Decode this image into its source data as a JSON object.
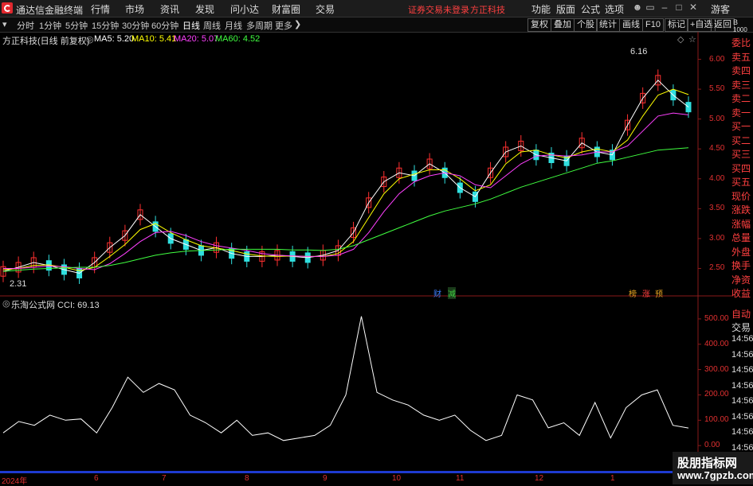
{
  "title_bar": {
    "app_name": "通达信金融终端",
    "menus": [
      "行情",
      "市场",
      "资讯",
      "发现",
      "问小达",
      "财富圈",
      "交易"
    ],
    "warning": "证券交易未登录",
    "stock_name": "方正科技",
    "right_menus": [
      "功能",
      "版面",
      "公式",
      "选项"
    ],
    "guest": "游客"
  },
  "toolbar": {
    "periods": [
      "分时",
      "1分钟",
      "5分钟",
      "15分钟",
      "30分钟",
      "60分钟",
      "日线",
      "周线",
      "月线",
      "多周期",
      "更多"
    ],
    "active_period": "日线",
    "buttons": [
      "复权",
      "叠加",
      "个股",
      "统计",
      "画线",
      "F10",
      "标记",
      "+自选",
      "返回"
    ]
  },
  "main_chart": {
    "header_title": "方正科技(日线 前复权)",
    "ma": [
      {
        "label": "MA5: 5.20",
        "color": "#ffffff"
      },
      {
        "label": "MA10: 5.41",
        "color": "#ffff00"
      },
      {
        "label": "MA20: 5.07",
        "color": "#ff40ff"
      },
      {
        "label": "MA60: 4.52",
        "color": "#40ff40"
      }
    ],
    "high_label": "6.16",
    "low_label": "2.31",
    "y_ticks": [
      "6.00",
      "5.50",
      "5.00",
      "4.50",
      "4.00",
      "3.50",
      "3.00",
      "2.50"
    ],
    "markers": [
      "财",
      "减",
      "榜",
      "涨",
      "预"
    ]
  },
  "sub_chart": {
    "header": "乐淘公式网 CCI: 69.13",
    "y_ticks": [
      "500.00",
      "400.00",
      "300.00",
      "200.00",
      "100.00",
      "0.00"
    ]
  },
  "right_panel": {
    "top_labels": [
      "委比",
      "卖五",
      "卖四",
      "卖三",
      "卖二",
      "卖一",
      "买一",
      "买二",
      "买三",
      "买四",
      "买五",
      "现价",
      "涨跌",
      "涨幅",
      "总量",
      "外盘",
      "换手",
      "净资",
      "收益"
    ],
    "mid_labels": [
      "自动",
      "交易"
    ],
    "times": [
      "14:56",
      "14:56",
      "14:56",
      "14:56",
      "14:56",
      "14:56",
      "14:56",
      "14:56",
      "14:56"
    ],
    "small_top": "B",
    "small_top2": "1000"
  },
  "date_axis": [
    "2024年",
    "6",
    "7",
    "8",
    "9",
    "10",
    "11",
    "12",
    "1"
  ],
  "watermark": {
    "line1": "股朋指标网",
    "line2": "www.7gpzb.com"
  },
  "chart_data": [
    {
      "type": "candlestick",
      "title": "方正科技(日线 前复权)",
      "x_ticks": [
        "2024年",
        "6",
        "7",
        "8",
        "9",
        "10",
        "11",
        "12",
        "1"
      ],
      "ylim": [
        2.2,
        6.3
      ],
      "series": [
        {
          "name": "MA5",
          "values": [
            2.45,
            2.52,
            2.6,
            2.55,
            2.48,
            2.42,
            2.6,
            2.85,
            3.05,
            3.4,
            3.2,
            3.0,
            2.9,
            2.8,
            2.85,
            2.75,
            2.7,
            2.7,
            2.72,
            2.7,
            2.68,
            2.72,
            2.8,
            3.1,
            3.6,
            3.95,
            4.1,
            4.05,
            4.25,
            4.1,
            3.85,
            3.7,
            4.1,
            4.45,
            4.55,
            4.4,
            4.35,
            4.3,
            4.6,
            4.45,
            4.4,
            4.9,
            5.35,
            5.65,
            5.4,
            5.2
          ]
        },
        {
          "name": "MA10",
          "values": [
            2.48,
            2.5,
            2.55,
            2.56,
            2.52,
            2.46,
            2.52,
            2.7,
            2.9,
            3.15,
            3.25,
            3.1,
            2.98,
            2.88,
            2.84,
            2.8,
            2.74,
            2.71,
            2.7,
            2.71,
            2.7,
            2.7,
            2.75,
            2.95,
            3.35,
            3.75,
            4.0,
            4.08,
            4.15,
            4.15,
            4.0,
            3.8,
            3.9,
            4.25,
            4.45,
            4.48,
            4.4,
            4.35,
            4.45,
            4.5,
            4.45,
            4.65,
            5.05,
            5.4,
            5.5,
            5.41
          ]
        },
        {
          "name": "MA20",
          "values": [
            2.5,
            2.5,
            2.52,
            2.54,
            2.53,
            2.5,
            2.48,
            2.58,
            2.75,
            2.95,
            3.1,
            3.12,
            3.05,
            2.95,
            2.88,
            2.84,
            2.8,
            2.75,
            2.72,
            2.71,
            2.7,
            2.7,
            2.72,
            2.82,
            3.1,
            3.45,
            3.75,
            3.95,
            4.05,
            4.1,
            4.05,
            3.9,
            3.85,
            4.05,
            4.25,
            4.38,
            4.4,
            4.38,
            4.4,
            4.45,
            4.45,
            4.55,
            4.8,
            5.05,
            5.1,
            5.07
          ]
        },
        {
          "name": "MA60",
          "values": [
            2.45,
            2.47,
            2.49,
            2.5,
            2.51,
            2.52,
            2.52,
            2.55,
            2.6,
            2.66,
            2.72,
            2.76,
            2.79,
            2.8,
            2.81,
            2.82,
            2.82,
            2.82,
            2.82,
            2.81,
            2.81,
            2.8,
            2.82,
            2.88,
            2.98,
            3.08,
            3.18,
            3.28,
            3.38,
            3.46,
            3.52,
            3.58,
            3.66,
            3.76,
            3.86,
            3.94,
            4.02,
            4.1,
            4.18,
            4.26,
            4.3,
            4.36,
            4.42,
            4.48,
            4.5,
            4.52
          ]
        }
      ]
    },
    {
      "type": "line",
      "title": "CCI",
      "ylim": [
        -100,
        550
      ],
      "series": [
        {
          "name": "CCI",
          "values": [
            50,
            95,
            80,
            120,
            100,
            105,
            50,
            150,
            270,
            210,
            245,
            220,
            120,
            90,
            50,
            100,
            40,
            50,
            20,
            30,
            40,
            80,
            200,
            510,
            210,
            180,
            160,
            120,
            100,
            120,
            60,
            20,
            40,
            200,
            180,
            70,
            90,
            40,
            170,
            30,
            150,
            200,
            220,
            80,
            69.13
          ]
        }
      ]
    }
  ]
}
